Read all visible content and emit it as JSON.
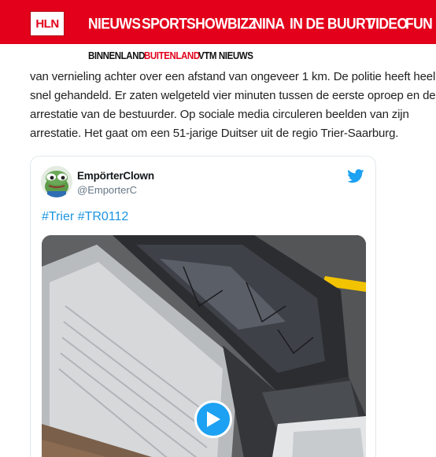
{
  "header": {
    "logo_text": "HLN",
    "nav": [
      {
        "label": "NIEUWS"
      },
      {
        "label": "SPORT"
      },
      {
        "label": "SHOWBIZZ"
      },
      {
        "label": "NINA"
      },
      {
        "label": "IN DE BUURT"
      },
      {
        "label": "VIDEO"
      },
      {
        "label": "FUN"
      }
    ],
    "active_nav": "NIEUWS",
    "brand_color": "#e3001b"
  },
  "subnav": {
    "items": [
      {
        "label": "BINNENLAND"
      },
      {
        "label": "BUITENLAND"
      },
      {
        "label": "VTM NIEUWS"
      }
    ],
    "active": "BUITENLAND"
  },
  "article": {
    "lines": [
      "van vernieling achter over een afstand van ongeveer 1 km. De politie heeft heel",
      "snel gehandeld. Er zaten welgeteld vier minuten tussen de eerste oproep en de",
      "arrestatie van de bestuurder. Op sociale media circuleren beelden van zijn",
      "arrestatie. Het gaat om een 51-jarige Duitser uit de regio Trier-Saarburg."
    ]
  },
  "tweet": {
    "user_name": "EmpörterClown",
    "user_handle": "@EmporterC",
    "hashtags": [
      "#Trier",
      "#TR0112"
    ],
    "icons": {
      "brand": "twitter-bird-icon",
      "play": "play-icon",
      "avatar": "frog-avatar"
    },
    "colors": {
      "link": "#1b95e0",
      "play_button": "#1da1f2"
    }
  }
}
